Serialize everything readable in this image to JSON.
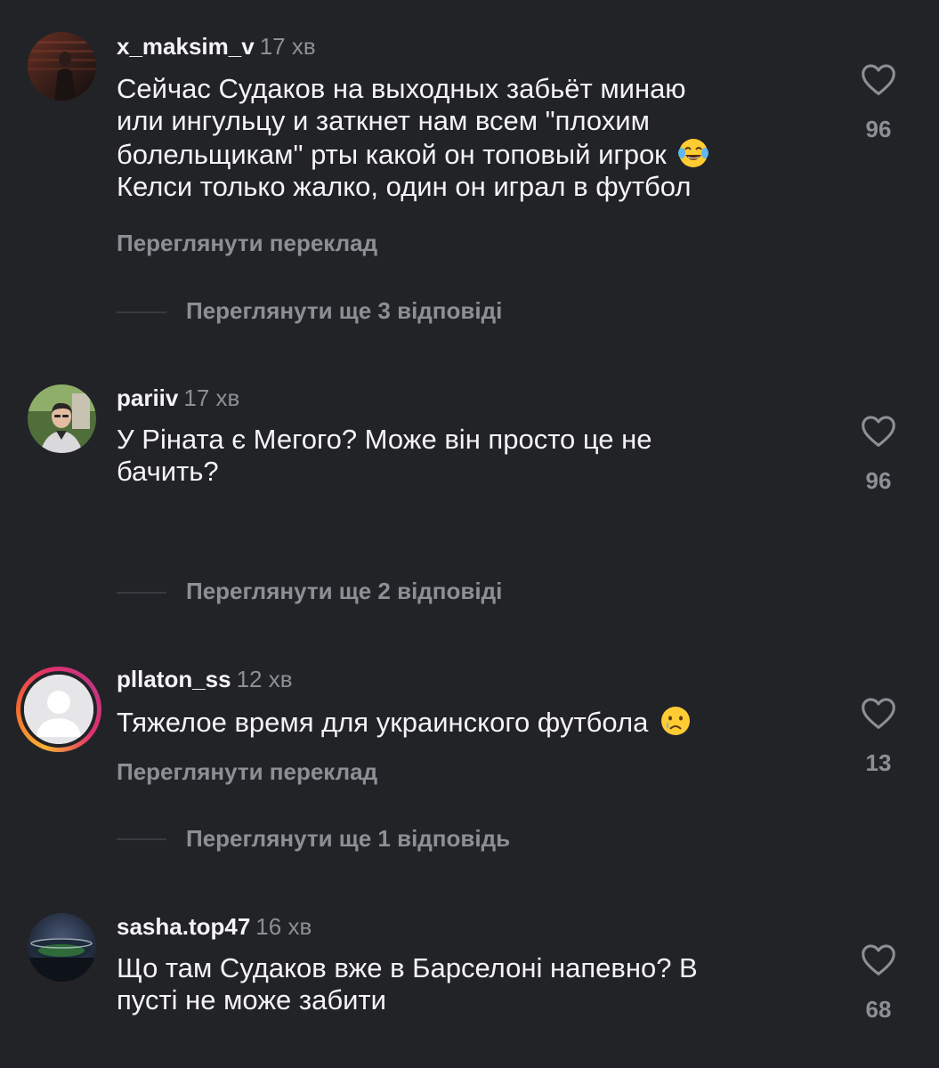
{
  "comments": [
    {
      "username": "x_maksim_v",
      "time": "17 хв",
      "text_lines": [
        "Сейчас Судаков на выходных забьёт минаю",
        "или ингульцу и заткнет нам всем \"плохим",
        "болельщикам\" рты какой он топовый игрок",
        "Келси только жалко, один он играл в футбол"
      ],
      "emoji": "joy-emoji",
      "translate_label": "Переглянути переклад",
      "replies_label": "Переглянути ще 3 відповіді",
      "likes": "96"
    },
    {
      "username": "pariiv",
      "time": "17 хв",
      "text_lines": [
        "У Ріната є Мегого? Може він просто це не",
        "бачить?"
      ],
      "replies_label": "Переглянути ще 2 відповіді",
      "likes": "96"
    },
    {
      "username": "pllaton_ss",
      "time": "12 хв",
      "text_lines": [
        "Тяжелое время для украинского футбола"
      ],
      "emoji": "crying-emoji",
      "translate_label": "Переглянути переклад",
      "replies_label": "Переглянути ще 1 відповідь",
      "likes": "13"
    },
    {
      "username": "sasha.top47",
      "time": "16 хв",
      "text_lines": [
        "Що там Судаков вже в Барселоні напевно? В",
        "пусті не може забити"
      ],
      "likes": "68"
    }
  ],
  "colors": {
    "background": "#222327",
    "primary_text": "#f4f4f5",
    "secondary_text": "#8e8f94",
    "story_ring": [
      "#f9b233",
      "#e1306c",
      "#c13584"
    ]
  }
}
